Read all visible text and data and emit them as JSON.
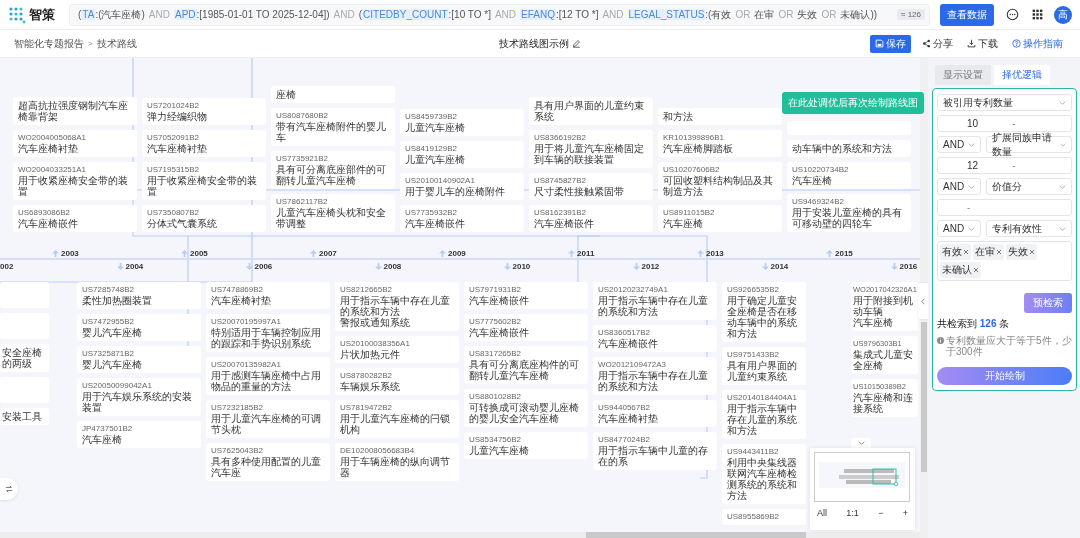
{
  "app": {
    "name": "智策",
    "avatar": "高"
  },
  "query": {
    "tokens": [
      {
        "kind": "text",
        "text": "("
      },
      {
        "kind": "field",
        "text": "TA"
      },
      {
        "kind": "text",
        "text": ":(汽车座椅)"
      },
      {
        "kind": "op",
        "text": "AND"
      },
      {
        "kind": "field",
        "text": "APD"
      },
      {
        "kind": "text",
        "text": ":[1985-01-01 TO 2025-12-04])"
      },
      {
        "kind": "op",
        "text": "AND"
      },
      {
        "kind": "text",
        "text": "("
      },
      {
        "kind": "field",
        "text": "CITEDBY_COUNT"
      },
      {
        "kind": "text",
        "text": ":[10 TO *]"
      },
      {
        "kind": "op",
        "text": "AND"
      },
      {
        "kind": "field",
        "text": "EFANQ"
      },
      {
        "kind": "text",
        "text": ":[12 TO *]"
      },
      {
        "kind": "op",
        "text": "AND"
      },
      {
        "kind": "field",
        "text": "LEGAL_STATUS"
      },
      {
        "kind": "text",
        "text": ":(有效"
      },
      {
        "kind": "op",
        "text": "OR"
      },
      {
        "kind": "text",
        "text": "在审"
      },
      {
        "kind": "op",
        "text": "OR"
      },
      {
        "kind": "text",
        "text": "失效"
      },
      {
        "kind": "op",
        "text": "OR"
      },
      {
        "kind": "text",
        "text": "未确认))"
      }
    ],
    "count": "≈ 126",
    "button": "查看数据"
  },
  "breadcrumb": {
    "items": [
      "智能化专题报告",
      "技术路线"
    ],
    "separator": ">"
  },
  "page_title": "技术路线图示例",
  "actions": [
    {
      "kind": "save",
      "label": "保存"
    },
    {
      "kind": "share",
      "label": "分享"
    },
    {
      "kind": "download",
      "label": "下载"
    },
    {
      "kind": "help",
      "label": "操作指南"
    }
  ],
  "canvas": {
    "upper_columns": [
      [
        {
          "title": "超高抗拉强度钢制汽车座椅靠背架"
        },
        {
          "number": "WO2004005068A1",
          "title": "汽车座椅衬垫"
        },
        {
          "number": "WO2004033251A1",
          "title": "用于收紧座椅安全带的装置"
        },
        {
          "number": "US6893086B2",
          "title": "汽车座椅嵌件"
        }
      ],
      [
        {
          "number": "US7201024B2",
          "title": "弹力经编织物"
        },
        {
          "number": "US7052091B2",
          "title": "汽车座椅衬垫"
        },
        {
          "number": "US7195315B2",
          "title": "用于收紧座椅安全带的装置"
        },
        {
          "number": "US7350807B2",
          "title": "分体式气囊系统"
        }
      ],
      [
        {
          "title": "座椅"
        },
        {
          "number": "US8087680B2",
          "title": "带有汽车座椅附件的婴儿车"
        },
        {
          "number": "US7735921B2",
          "title": "具有可分离底座部件的可翻转儿童汽车座椅"
        },
        {
          "number": "US7862117B2",
          "title": "儿童汽车座椅头枕和安全带调整"
        }
      ],
      [
        {
          "number": "US8459739B2",
          "title": "儿童汽车座椅"
        },
        {
          "number": "US8419129B2",
          "title": "儿童汽车座椅"
        },
        {
          "number": "US20100140902A1",
          "title": "用于婴儿车的座椅附件"
        },
        {
          "number": "US7735932B2",
          "title": "汽车座椅嵌件"
        }
      ],
      [
        {
          "title": "具有用户界面的儿童约束系统"
        },
        {
          "number": "US8366192B2",
          "title": "用于将儿童汽车座椅固定到车辆的联接装置"
        },
        {
          "number": "US8745827B2",
          "title": "尺寸柔性接触紧固带"
        },
        {
          "number": "US8162391B2",
          "title": "汽车座椅嵌件"
        }
      ],
      [
        {
          "title": "和方法"
        },
        {
          "number": "KR101399896B1",
          "title": "汽车座椅脚踏板"
        },
        {
          "number": "US10207606B2",
          "title": "可回收塑料结构制品及其制造方法"
        },
        {
          "number": "US8911015B2",
          "title": "汽车座椅"
        }
      ],
      [
        {},
        {
          "title": "动车辆中的系统和方法"
        },
        {
          "number": "US10220734B2",
          "title": "汽车座椅"
        },
        {
          "number": "US9469324B2",
          "title": "用于安装儿童座椅的具有可移动壁的四轮车"
        }
      ]
    ],
    "lower_columns": [
      [
        {},
        {},
        {
          "title": "安全座椅的两级"
        },
        {},
        {
          "title": "安装工具"
        }
      ],
      [
        {
          "number": "US7285748B2",
          "title": "柔性加热圈装置"
        },
        {
          "number": "US7472955B2",
          "title": "婴儿汽车座椅"
        },
        {
          "number": "US7325871B2",
          "title": "婴儿汽车座椅"
        },
        {
          "number": "US20050099042A1",
          "title": "用于汽车娱乐系统的安装装置"
        },
        {
          "number": "JP4737501B2",
          "title": "汽车座椅"
        }
      ],
      [
        {
          "number": "US7478869B2",
          "title": "汽车座椅衬垫"
        },
        {
          "number": "US20070195997A1",
          "title": "特别适用于车辆控制应用的跟踪和手势识别系统"
        },
        {
          "number": "US20070135982A1",
          "title": "用于感测车辆座椅中占用物品的重量的方法"
        },
        {
          "number": "US7232185B2",
          "title": "用于儿童汽车座椅的可调节头枕"
        },
        {
          "number": "US7625043B2",
          "title": "具有多种使用配置的儿童汽车座"
        }
      ],
      [
        {
          "number": "US8212665B2",
          "title": "用于指示车辆中存在儿童的系统和方法",
          "note": "警报或通知系统"
        },
        {
          "number": "US20100038356A1",
          "title": "片状加热元件"
        },
        {
          "number": "US8780282B2",
          "title": "车辆娱乐系统"
        },
        {
          "number": "US7819472B2",
          "title": "用于儿童汽车座椅的闩锁机构"
        },
        {
          "number": "DE102008056683B4",
          "title": "用于车辆座椅的纵向调节器"
        }
      ],
      [
        {
          "number": "US7971931B2",
          "title": "汽车座椅嵌件"
        },
        {
          "number": "US7775602B2",
          "title": "汽车座椅嵌件"
        },
        {
          "number": "US8317265B2",
          "title": "具有可分离底座构件的可翻转儿童汽车座椅"
        },
        {
          "number": "US8801028B2",
          "title": "可转换成可滚动婴儿座椅的婴儿安全汽车座椅"
        },
        {
          "number": "US8534756B2",
          "title": "儿童汽车座椅"
        }
      ],
      [
        {
          "number": "US20120232749A1",
          "title": "用于指示车辆中存在儿童的系统和方法"
        },
        {
          "number": "US8360517B2",
          "title": "汽车座椅嵌件"
        },
        {
          "number": "WO2012109472A3",
          "title": "用于指示车辆中存在儿童的系统和方法"
        },
        {
          "number": "US9440567B2",
          "title": "汽车座椅衬垫"
        },
        {
          "number": "US8477024B2",
          "title": "用于指示车辆中儿童的存在的系"
        }
      ],
      [
        {
          "number": "US9266535B2",
          "title": "用于确定儿童安全座椅是否在移动车辆中的系统和方法"
        },
        {
          "number": "US9751433B2",
          "title": "具有用户界面的儿童约束系统"
        },
        {
          "number": "US20140184404A1",
          "title": "用于指示车辆中存在儿童的系统和方法"
        },
        {
          "number": "US9443411B2",
          "title": "利用中央集线器联网汽车座椅检测系统的系统和方法"
        },
        {
          "number": "US8955869B2"
        }
      ],
      [
        {
          "number": "WO2017042326A1",
          "title": "用于附接到机动车辆",
          "note": "汽车座椅"
        },
        {
          "number": "US9796303B1",
          "title": "集成式儿童安全座椅"
        },
        {
          "number": "US10150389B2",
          "title": "汽车座椅和连接系统"
        }
      ]
    ],
    "years": [
      "002",
      "2003",
      "2004",
      "2005",
      "2006",
      "2007",
      "2008",
      "2009",
      "2010",
      "2011",
      "2012",
      "2013",
      "2014",
      "2015",
      "2016"
    ],
    "tooltip": "在此处调优后再次绘制路线图",
    "minimap": {
      "expanded": true,
      "controls": [
        "All",
        "1:1",
        "−",
        "+"
      ]
    }
  },
  "panel": {
    "tabs": [
      {
        "label": "显示设置",
        "selected": false
      },
      {
        "label": "择优逻辑",
        "selected": true
      }
    ],
    "rules": [
      {
        "kind": "select",
        "value": "被引用专利数量"
      },
      {
        "kind": "range",
        "from": "10",
        "sep": "-"
      },
      {
        "kind": "logic",
        "op": "AND",
        "value": "扩展同族申请数量"
      },
      {
        "kind": "range",
        "from": "12",
        "sep": "-"
      },
      {
        "kind": "logic",
        "op": "AND",
        "value": "价值分"
      },
      {
        "kind": "range",
        "sep": "-"
      },
      {
        "kind": "logic",
        "op": "AND",
        "value": "专利有效性"
      },
      {
        "kind": "tags",
        "tags": [
          "有效",
          "在审",
          "失效",
          "未确认"
        ]
      }
    ],
    "precheck_button": "预检索",
    "result": "共检索到 **126** 条",
    "note": "专利数量应大于等于5件，少于300件",
    "draw_button": "开始绘制"
  }
}
